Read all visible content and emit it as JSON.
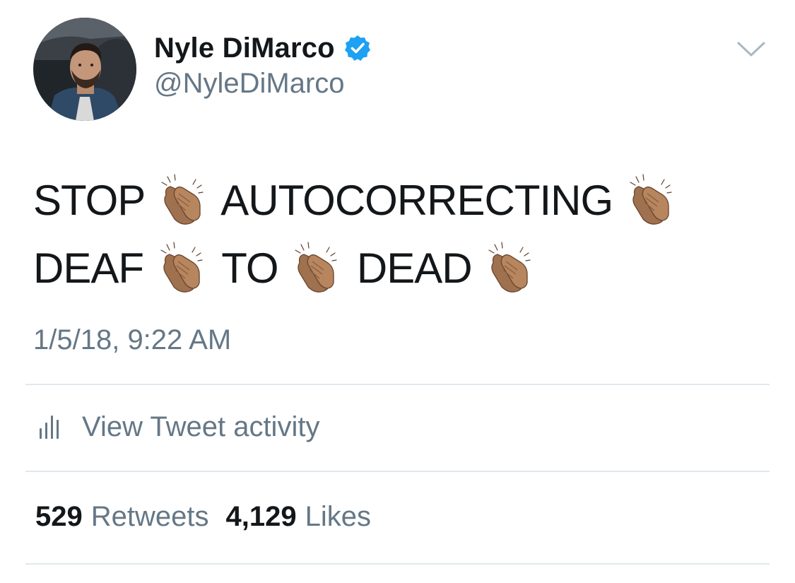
{
  "tweet": {
    "author": {
      "display_name": "Nyle DiMarco",
      "handle": "@NyleDiMarco",
      "verified": true,
      "avatar_icon": "profile-photo"
    },
    "text_tokens": [
      {
        "type": "word",
        "value": "STOP"
      },
      {
        "type": "emoji",
        "value": "👏🏽"
      },
      {
        "type": "word",
        "value": "AUTOCORRECTING"
      },
      {
        "type": "emoji",
        "value": "👏🏽"
      },
      {
        "type": "word",
        "value": "DEAF"
      },
      {
        "type": "emoji",
        "value": "👏🏽"
      },
      {
        "type": "word",
        "value": "TO"
      },
      {
        "type": "emoji",
        "value": "👏🏽"
      },
      {
        "type": "word",
        "value": "DEAD"
      },
      {
        "type": "emoji",
        "value": "👏🏽"
      }
    ],
    "timestamp": "1/5/18, 9:22 AM",
    "activity_label": "View Tweet activity",
    "stats": {
      "retweets_count": "529",
      "retweets_label": "Retweets",
      "likes_count": "4,129",
      "likes_label": "Likes"
    }
  },
  "colors": {
    "text_primary": "#14171a",
    "text_secondary": "#657786",
    "verified_blue": "#1da1f2",
    "divider": "#e1e8ed",
    "caret": "#aab8c2"
  }
}
